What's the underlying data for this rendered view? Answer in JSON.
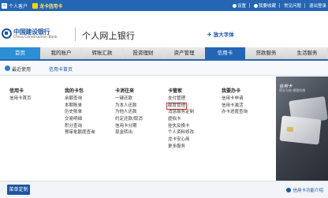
{
  "topbar": {
    "home_icon": "home-icon",
    "personal_label": "个人客户",
    "brand_label": "龙卡信用卡",
    "links": [
      {
        "icon": "settings-icon",
        "label": "设置"
      },
      {
        "icon": "bookmark-icon",
        "label": "我要收藏"
      },
      {
        "icon": "help-icon",
        "label": "常见问题"
      },
      {
        "icon": "logout-icon",
        "label": "退出登录"
      }
    ]
  },
  "header": {
    "bank_name_cn": "中国建设银行",
    "bank_name_en": "China Construction Bank",
    "site_name": "个人网上银行",
    "big_font_label": "放大字体"
  },
  "nav": {
    "tabs": [
      "首页",
      "我的账户",
      "转账汇款",
      "投资理财",
      "资产管理",
      "信用卡",
      "贷款服务",
      "生活服务"
    ],
    "active_index": 5,
    "home_index": 0
  },
  "subbar": {
    "common_label": "最近使用",
    "home_label": "信用卡首页"
  },
  "menu": {
    "columns": [
      {
        "title": "信用卡",
        "items": [
          "信用卡首页"
        ]
      },
      {
        "title": "我的卡包",
        "items": [
          "余额查询",
          "本期账单",
          "历史账单",
          "交易明细",
          "积分查询",
          "预审批额度查询"
        ]
      },
      {
        "title": "卡消往来",
        "items": [
          "一键还款",
          "为本人还款",
          "为他人还款",
          "约定还款/取消",
          "信用卡分期",
          "现金转出"
        ]
      },
      {
        "title": "卡管家",
        "items": [
          "支付管理",
          "额度管理",
          "消息服务定制",
          "虚拟卡",
          "挂失及换卡",
          "个人资料修改",
          "龙卡安心用",
          "更多服务"
        ]
      },
      {
        "title": "我要办卡",
        "items": [
          "信用卡申请",
          "信用卡激活",
          "办卡进度查询"
        ]
      }
    ],
    "highlighted": {
      "column": 3,
      "item": 1
    }
  },
  "promo": {
    "title": "信用卡",
    "subtitle": "积分与你 想我所想"
  },
  "footer": {
    "custom_button": "菜单定制",
    "guide_link": "信用卡功能介绍"
  },
  "colors": {
    "primary": "#2466b4",
    "highlight_border": "#e03030"
  }
}
